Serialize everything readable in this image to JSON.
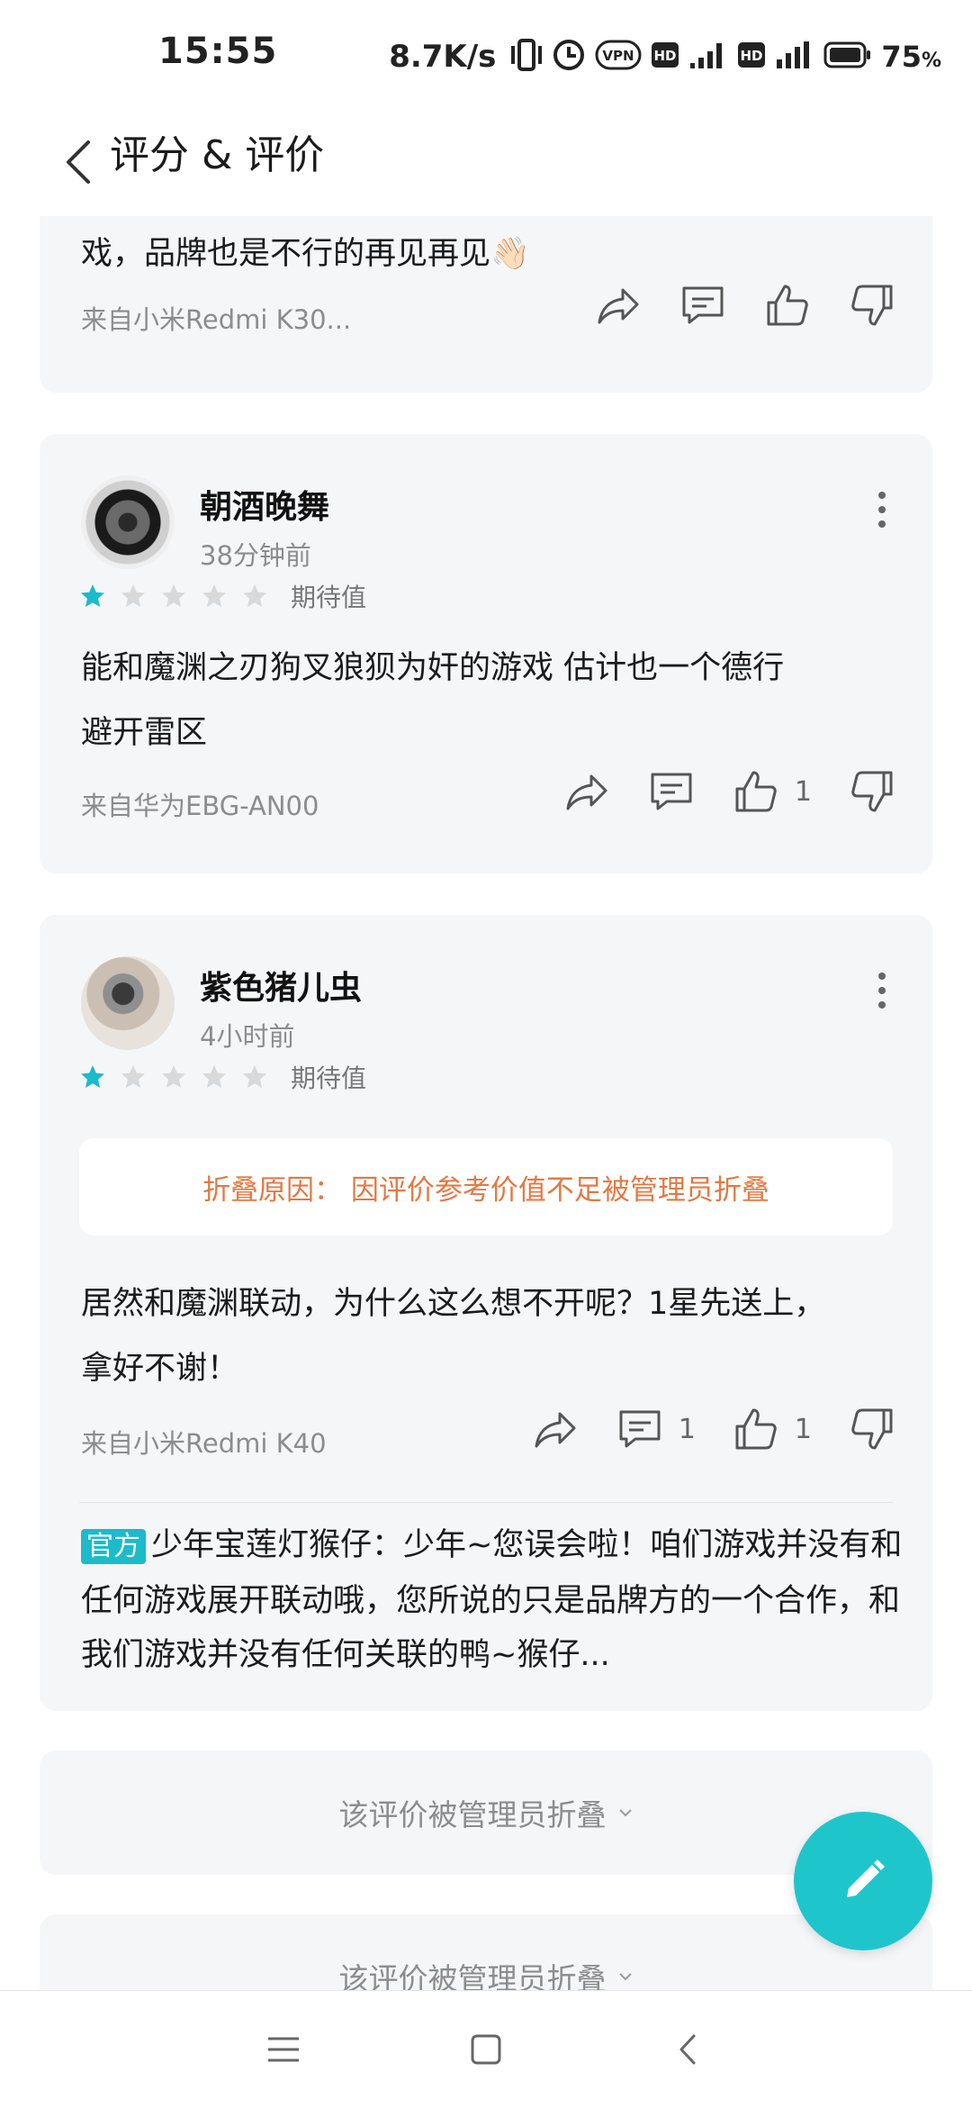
{
  "status_bar": {
    "time": "15:55",
    "net_speed": "8.7K/s",
    "battery_pct": "75",
    "battery_unit": "%",
    "icons": [
      "vibrate-icon",
      "alarm-icon",
      "vpn-icon",
      "hd-icon",
      "signal-icon",
      "hd-icon",
      "signal-icon",
      "battery-icon"
    ]
  },
  "header": {
    "title": "评分 & 评价",
    "back_icon": "chevron-left-icon"
  },
  "reviews": [
    {
      "partial": true,
      "text": "戏，品牌也是不行的再见再见👋🏻",
      "source": "来自小米Redmi K30...",
      "like_count": "",
      "comment_count": ""
    },
    {
      "user": "朝酒晚舞",
      "time": "38分钟前",
      "rating": 1,
      "max_rating": 5,
      "rating_label": "期待值",
      "text_lines": [
        "能和魔渊之刃狗叉狼狈为奸的游戏 估计也一个德行",
        "避开雷区"
      ],
      "source": "来自华为EBG-AN00",
      "comment_count": "",
      "like_count": "1"
    },
    {
      "user": "紫色猪儿虫",
      "time": "4小时前",
      "rating": 1,
      "max_rating": 5,
      "rating_label": "期待值",
      "fold_reason": "折叠原因：  因评价参考价值不足被管理员折叠",
      "text_lines": [
        "居然和魔渊联动，为什么这么想不开呢？1星先送上，",
        "拿好不谢！"
      ],
      "source": "来自小米Redmi K40",
      "comment_count": "1",
      "like_count": "1",
      "official_reply": {
        "badge": "官方",
        "author": "少年宝莲灯猴仔",
        "separator": "：",
        "text": "少年~您误会啦！咱们游戏并没有和任何游戏展开联动哦，您所说的只是品牌方的一个合作，和我们游戏并没有任何关联的鸭~猴仔..."
      }
    }
  ],
  "collapsed_reviews": [
    {
      "text": "该评价被管理员折叠"
    },
    {
      "text": "该评价被管理员折叠"
    }
  ],
  "fab": {
    "icon": "pencil-icon"
  },
  "colors": {
    "accent": "#1ec6cc",
    "star_active": "#1cbbc9",
    "star_inactive": "#d9d9d9",
    "fold_reason": "#e07a44",
    "card_bg": "#f5f6f8"
  },
  "nav": {
    "icons": [
      "menu-icon",
      "home-icon",
      "back-icon"
    ]
  }
}
